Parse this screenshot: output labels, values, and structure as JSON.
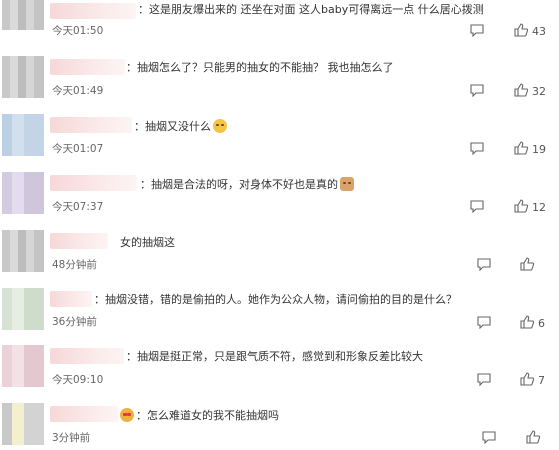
{
  "comments": [
    {
      "text": "：这是朋友爆出来的 还坐在对面 这人baby可得离远一点 什么居心拨测",
      "time": "今天01:50",
      "likes": "43",
      "emoji": ""
    },
    {
      "text": "：抽烟怎么了？只能男的抽女的不能抽？ 我也抽怎么了",
      "time": "今天01:49",
      "likes": "32",
      "emoji": ""
    },
    {
      "text": "：抽烟又没什么",
      "time": "今天01:07",
      "likes": "19",
      "emoji": "thinking-face"
    },
    {
      "text": "：抽烟是合法的呀，对身体不好也是真的",
      "time": "今天07:37",
      "likes": "12",
      "emoji": "dog-face"
    },
    {
      "text": "女的抽烟这",
      "time": "48分钟前",
      "likes": "",
      "emoji": ""
    },
    {
      "text": "：抽烟没错，错的是偷拍的人。她作为公众人物，请问偷拍的目的是什么？",
      "time": "36分钟前",
      "likes": "6",
      "emoji": ""
    },
    {
      "text": "：抽烟是挺正常，只是跟气质不符，感觉到和形象反差比较大",
      "time": "今天09:10",
      "likes": "7",
      "emoji": ""
    },
    {
      "text": "：怎么难道女的我不能抽烟吗",
      "time": "3分钟前",
      "likes": "",
      "emoji": "heart-eyes-face"
    }
  ],
  "icons": {
    "reply": "comment-icon",
    "like": "thumbs-up-icon"
  }
}
